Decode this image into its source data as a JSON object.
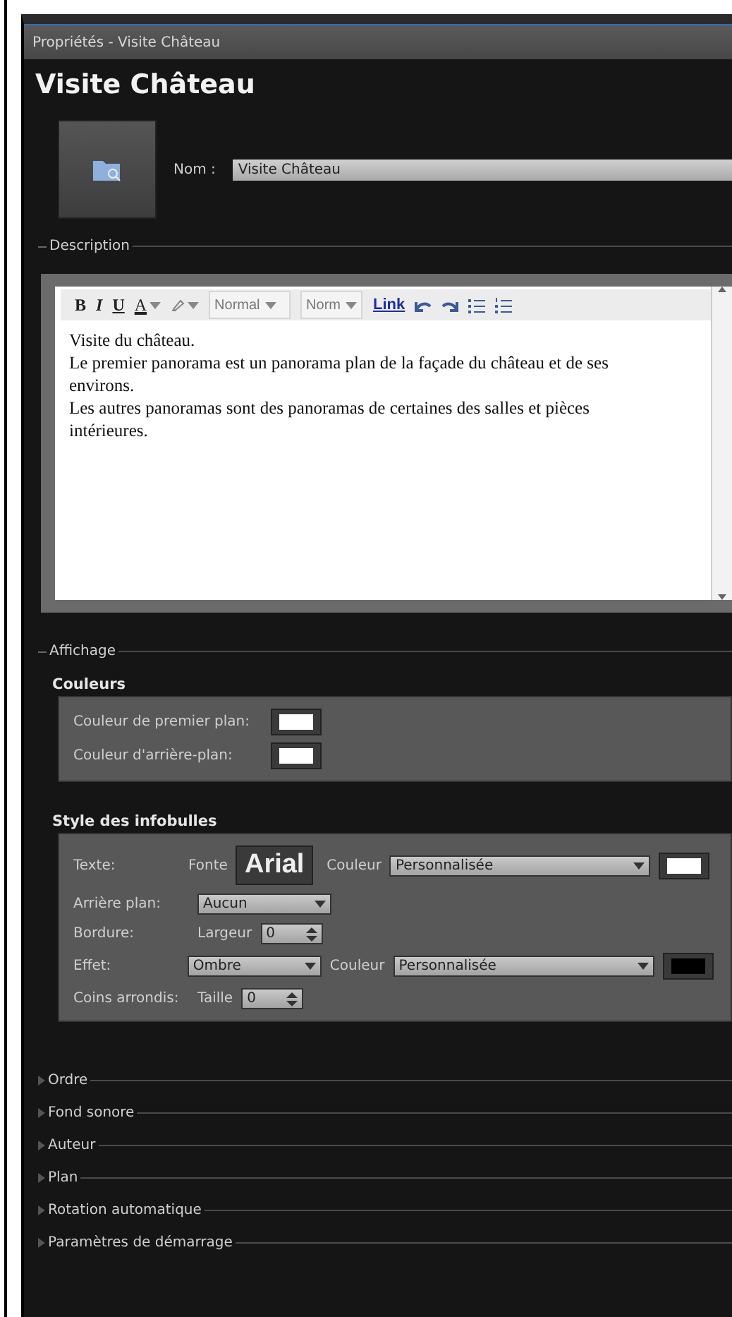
{
  "window": {
    "title": "Propriétés - Visite Château"
  },
  "heading": "Visite Château",
  "name_field": {
    "label": "Nom :",
    "value": "Visite Château"
  },
  "description": {
    "label": "Description",
    "expanded": true,
    "toolbar": [
      {
        "kind": "bold",
        "label": "B"
      },
      {
        "kind": "italic",
        "label": "I"
      },
      {
        "kind": "underline",
        "label": "U"
      },
      {
        "kind": "font_color",
        "label": "A"
      },
      {
        "kind": "highlight"
      },
      {
        "kind": "select",
        "label": "Normal"
      },
      {
        "kind": "select_small",
        "label": "Norm"
      },
      {
        "kind": "link",
        "label": "Link"
      },
      {
        "kind": "undo"
      },
      {
        "kind": "redo"
      },
      {
        "kind": "bullets"
      },
      {
        "kind": "numbers"
      }
    ],
    "paragraphs": [
      "Visite du château.",
      "Le premier panorama est un panorama plan de la façade du château et de ses environs.",
      "Les autres panoramas sont des panoramas de certaines des salles et pièces intérieures."
    ]
  },
  "display": {
    "label": "Affichage",
    "expanded": true,
    "colors": {
      "title": "Couleurs",
      "rows": [
        {
          "label": "Couleur de premier plan:",
          "color": "#ffffff"
        },
        {
          "label": "Couleur d'arrière-plan:",
          "color": "#ffffff"
        }
      ]
    },
    "tooltip_style": {
      "title": "Style des infobulles",
      "rows": [
        {
          "label": "Texte:",
          "items": [
            {
              "kind": "font",
              "caption": "Fonte",
              "value": "Arial"
            },
            {
              "kind": "color_select",
              "caption": "Couleur",
              "value": "Personnalisée",
              "color": "#ffffff"
            }
          ]
        },
        {
          "label": "Arrière plan:",
          "items": [
            {
              "kind": "select",
              "value": "Aucun"
            }
          ]
        },
        {
          "label": "Bordure:",
          "items": [
            {
              "kind": "spinner",
              "caption": "Largeur",
              "value": "0"
            }
          ]
        },
        {
          "label": "Effet:",
          "items": [
            {
              "kind": "select",
              "value": "Ombre"
            },
            {
              "kind": "color_select",
              "caption": "Couleur",
              "value": "Personnalisée",
              "color": "#000000"
            }
          ]
        },
        {
          "label": "Coins arrondis:",
          "items": [
            {
              "kind": "spinner",
              "caption": "Taille",
              "value": "0"
            }
          ]
        }
      ]
    }
  },
  "sections": [
    {
      "label": "Ordre",
      "expanded": false
    },
    {
      "label": "Fond sonore",
      "expanded": false
    },
    {
      "label": "Auteur",
      "expanded": false
    },
    {
      "label": "Plan",
      "expanded": false
    },
    {
      "label": "Rotation automatique",
      "expanded": false
    },
    {
      "label": "Paramètres de démarrage",
      "expanded": false
    }
  ]
}
